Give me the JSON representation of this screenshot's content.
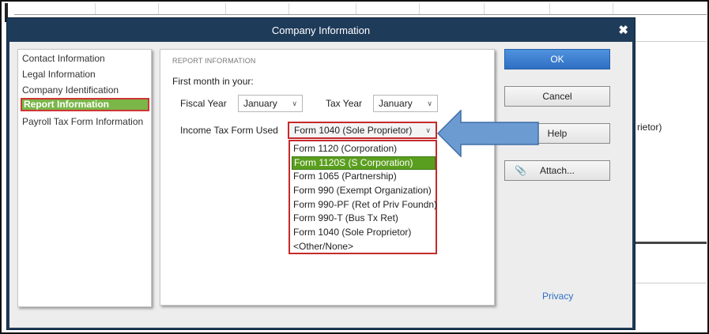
{
  "background": {
    "partial_text": "rietor)"
  },
  "dialog": {
    "title": "Company Information",
    "close_glyph": "✖"
  },
  "nav": {
    "items": [
      {
        "label": "Contact Information",
        "selected": false
      },
      {
        "label": "Legal Information",
        "selected": false
      },
      {
        "label": "Company Identification",
        "selected": false
      },
      {
        "label": "Report Information",
        "selected": true
      },
      {
        "label": "Payroll Tax Form Information",
        "selected": false
      }
    ]
  },
  "report": {
    "heading": "REPORT INFORMATION",
    "first_month_label": "First month in your:",
    "fiscal_year_label": "Fiscal Year",
    "fiscal_year_value": "January",
    "tax_year_label": "Tax Year",
    "tax_year_value": "January",
    "income_tax_label": "Income Tax Form Used",
    "income_tax_value": "Form 1040 (Sole Proprietor)",
    "dropdown_options": [
      {
        "label": "Form 1120 (Corporation)",
        "highlighted": false
      },
      {
        "label": "Form 1120S (S Corporation)",
        "highlighted": true
      },
      {
        "label": "Form 1065 (Partnership)",
        "highlighted": false
      },
      {
        "label": "Form 990 (Exempt Organization)",
        "highlighted": false
      },
      {
        "label": "Form 990-PF (Ret of Priv Foundn)",
        "highlighted": false
      },
      {
        "label": "Form 990-T (Bus Tx Ret)",
        "highlighted": false
      },
      {
        "label": "Form 1040 (Sole Proprietor)",
        "highlighted": false
      },
      {
        "label": "<Other/None>",
        "highlighted": false
      }
    ]
  },
  "buttons": {
    "ok": "OK",
    "cancel": "Cancel",
    "help": "Help",
    "attach": "Attach...",
    "attach_icon": "paperclip-icon"
  },
  "privacy": "Privacy",
  "colors": {
    "titlebar": "#1f3b5a",
    "selected_nav": "#7ab648",
    "highlight_option": "#5a9e1f",
    "red_outline": "#c52a2a",
    "ok_button": "#2f6fc4",
    "callout_arrow": "#6b9bd1"
  }
}
